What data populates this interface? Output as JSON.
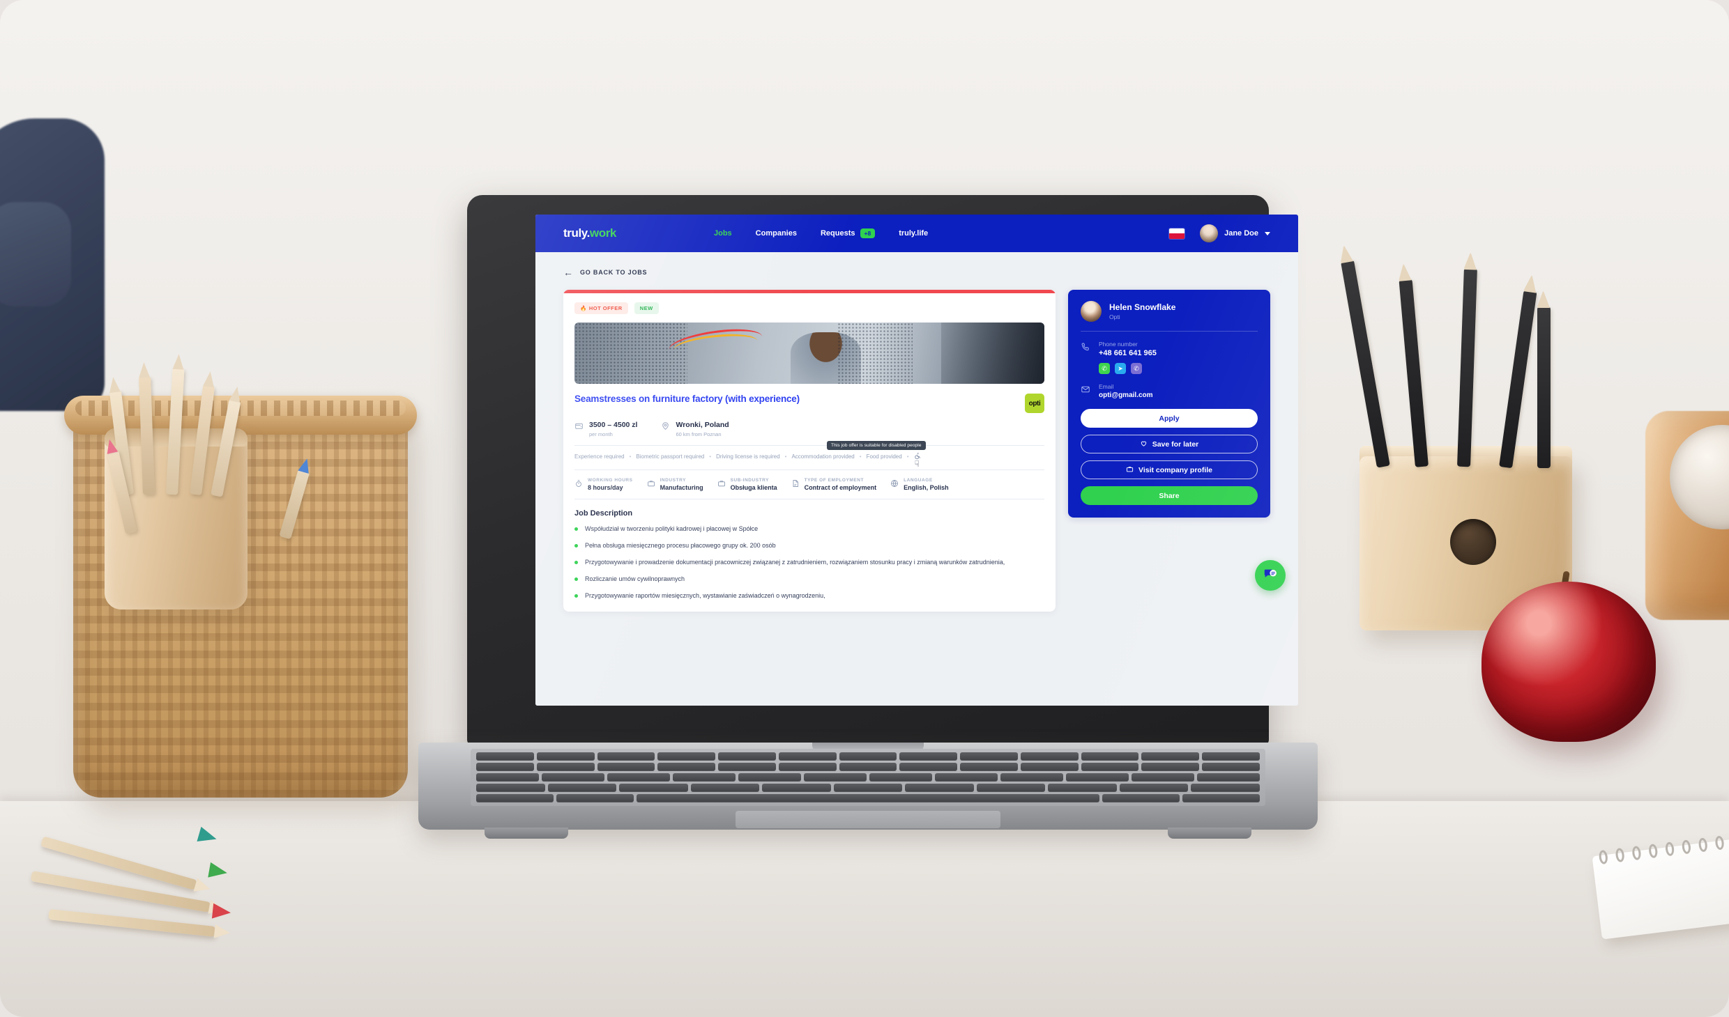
{
  "nav": {
    "logo_truly": "truly",
    "logo_dot": ".",
    "logo_work": "work",
    "links": [
      {
        "label": "Jobs",
        "active": true,
        "badge": null
      },
      {
        "label": "Companies",
        "active": false,
        "badge": null
      },
      {
        "label": "Requests",
        "active": false,
        "badge": "+8"
      },
      {
        "label": "truly.life",
        "active": false,
        "badge": null
      }
    ],
    "flag": "poland-flag",
    "user_name": "Jane Doe"
  },
  "back_link": {
    "arrow": "←",
    "label": "GO BACK TO JOBS"
  },
  "job": {
    "badges": [
      {
        "label": "HOT OFFER",
        "icon": "🔥",
        "type": "hot"
      },
      {
        "label": "NEW",
        "icon": "",
        "type": "new"
      }
    ],
    "title": "Seamstresses on furniture factory (with experience)",
    "company_logo_text": "opti",
    "salary": {
      "amount": "3500 – 4500 zl",
      "period": "per month"
    },
    "location": {
      "city": "Wronki, Poland",
      "distance": "60 km from Poznan"
    },
    "tags": [
      "Experience required",
      "Biometric passport required",
      "Driving license is required",
      "Accommodation provided",
      "Food provided"
    ],
    "tag_separator": "•",
    "accessibility_tooltip": "This job offer is suitable for disabled people",
    "meta": [
      {
        "label": "WORKING HOURS",
        "value": "8 hours/day",
        "icon": "stopwatch-icon"
      },
      {
        "label": "INDUSTRY",
        "value": "Manufacturing",
        "icon": "briefcase-icon"
      },
      {
        "label": "SUB-INDUSTRY",
        "value": "Obsługa klienta",
        "icon": "briefcase-icon"
      },
      {
        "label": "TYPE OF EMPLOYMENT",
        "value": "Contract of employment",
        "icon": "document-check-icon"
      },
      {
        "label": "LANGUAGE",
        "value": "English, Polish",
        "icon": "globe-icon"
      }
    ],
    "description_title": "Job Description",
    "description_bullets": [
      "Współudział w tworzeniu polityki kadrowej i płacowej w Spółce",
      "Pełna obsługa miesięcznego procesu płacowego grupy ok. 200 osób",
      "Przygotowywanie i prowadzenie dokumentacji pracowniczej związanej z zatrudnieniem, rozwiązaniem stosunku pracy i zmianą warunków zatrudnienia,",
      "Rozliczanie umów cywilnoprawnych",
      "Przygotowywanie raportów miesięcznych, wystawianie zaświadczeń o wynagrodzeniu,"
    ]
  },
  "sidebar": {
    "contact_name": "Helen Snowflake",
    "contact_org": "Opti",
    "phone_label": "Phone number",
    "phone_value": "+48 661 641 965",
    "messengers": [
      {
        "name": "whatsapp-icon",
        "glyph": "✆"
      },
      {
        "name": "telegram-icon",
        "glyph": "➤"
      },
      {
        "name": "viber-icon",
        "glyph": "✆"
      }
    ],
    "email_label": "Email",
    "email_value": "opti@gmail.com",
    "buttons": [
      {
        "label": "Apply",
        "style": "apply",
        "icon": null
      },
      {
        "label": "Save for later",
        "style": "outline",
        "icon": "heart-icon"
      },
      {
        "label": "Visit company profile",
        "style": "outline",
        "icon": "briefcase-icon"
      },
      {
        "label": "Share",
        "style": "share",
        "icon": null
      }
    ]
  },
  "chat_widget": {
    "icon": "chat-bubble-icon"
  },
  "colors": {
    "brand_blue": "#0c1fbf",
    "accent_green": "#2fd14e",
    "title_blue": "#2d3ff0",
    "accent_red": "#f0484e",
    "logo_lime": "#b0d62d"
  }
}
